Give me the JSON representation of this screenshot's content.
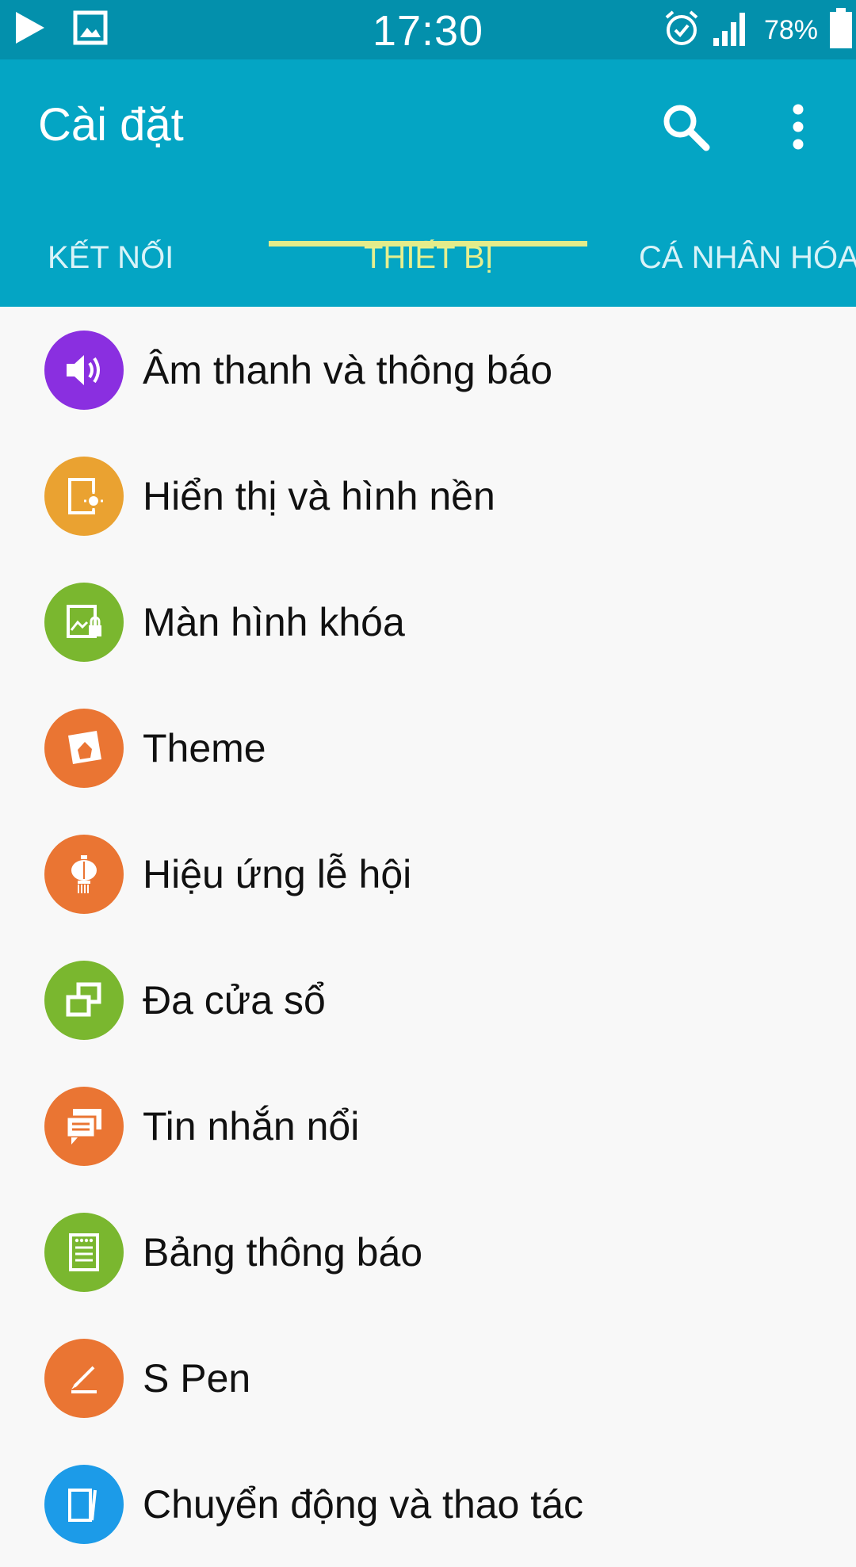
{
  "status_bar": {
    "time": "17:30",
    "battery_percent": "78%",
    "signal_bars": 4,
    "icons": [
      "play-icon",
      "gallery-icon",
      "alarm-icon",
      "signal-icon",
      "battery-icon"
    ]
  },
  "app_bar": {
    "title": "Cài đặt",
    "background_color": "#04a5c4",
    "status_color": "#0390ac",
    "actions": [
      "search-icon",
      "more-options-icon"
    ]
  },
  "tabs": {
    "items": [
      {
        "label": "KẾT NỐI",
        "active": false
      },
      {
        "label": "THIẾT BỊ",
        "active": true
      },
      {
        "label": "CÁ NHÂN HÓA",
        "active": false
      }
    ],
    "active_color": "#e6ef8f"
  },
  "settings": {
    "items": [
      {
        "label": "Âm thanh và thông báo",
        "icon": "speaker-icon",
        "color": "#8a2fe0"
      },
      {
        "label": "Hiển thị và hình nền",
        "icon": "display-brightness-icon",
        "color": "#eaa231"
      },
      {
        "label": "Màn hình khóa",
        "icon": "lock-screen-icon",
        "color": "#7ab72f"
      },
      {
        "label": "Theme",
        "icon": "theme-icon",
        "color": "#ea7533"
      },
      {
        "label": "Hiệu ứng lễ hội",
        "icon": "lantern-icon",
        "color": "#ea7533"
      },
      {
        "label": "Đa cửa sổ",
        "icon": "multi-window-icon",
        "color": "#7ab72f"
      },
      {
        "label": "Tin nhắn nổi",
        "icon": "floating-message-icon",
        "color": "#ea7533"
      },
      {
        "label": "Bảng thông báo",
        "icon": "notification-panel-icon",
        "color": "#7ab72f"
      },
      {
        "label": "S Pen",
        "icon": "pen-icon",
        "color": "#ea7533"
      },
      {
        "label": "Chuyển động và thao tác",
        "icon": "motion-icon",
        "color": "#1c9be8"
      }
    ]
  }
}
